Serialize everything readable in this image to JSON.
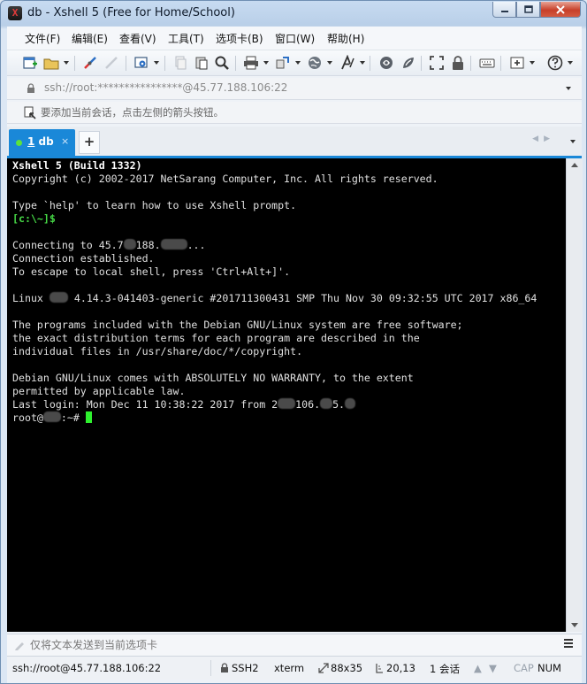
{
  "window": {
    "title": "db - Xshell 5 (Free for Home/School)",
    "icon_glyph": "X"
  },
  "menu": [
    {
      "label": "文件(F)"
    },
    {
      "label": "编辑(E)"
    },
    {
      "label": "查看(V)"
    },
    {
      "label": "工具(T)"
    },
    {
      "label": "选项卡(B)"
    },
    {
      "label": "窗口(W)"
    },
    {
      "label": "帮助(H)"
    }
  ],
  "address": {
    "value": "ssh://root:****************@45.77.188.106:22"
  },
  "session_hint": {
    "text": "要添加当前会话，点击左侧的箭头按钮。"
  },
  "tabs": [
    {
      "number": "1",
      "label": "db",
      "close": "×",
      "status_color": "#5be33d"
    }
  ],
  "tab_add": "+",
  "terminal": {
    "lines": [
      {
        "text": "Xshell 5 (Build 1332)",
        "style": "bold"
      },
      {
        "text": "Copyright (c) 2002-2017 NetSarang Computer, Inc. All rights reserved."
      },
      {
        "text": ""
      },
      {
        "text": "Type `help' to learn how to use Xshell prompt."
      },
      {
        "text": "[c:\\~]$",
        "style": "green"
      },
      {
        "text": ""
      },
      {
        "text_a": "Connecting to 45.7",
        "text_b": "188.",
        "text_c": "...",
        "redact": [
          1,
          2
        ]
      },
      {
        "text": "Connection established."
      },
      {
        "text": "To escape to local shell, press 'Ctrl+Alt+]'."
      },
      {
        "text": ""
      },
      {
        "text_a": "Linux ",
        "text_b": " 4.14.3-041403-generic #201711300431 SMP Thu Nov 30 09:32:55 UTC 2017 x86_64"
      },
      {
        "text": ""
      },
      {
        "text": "The programs included with the Debian GNU/Linux system are free software;"
      },
      {
        "text": "the exact distribution terms for each program are described in the"
      },
      {
        "text": "individual files in /usr/share/doc/*/copyright."
      },
      {
        "text": ""
      },
      {
        "text": "Debian GNU/Linux comes with ABSOLUTELY NO WARRANTY, to the extent"
      },
      {
        "text": "permitted by applicable law."
      },
      {
        "text_a": "Last login: Mon Dec 11 10:38:22 2017 from 2",
        "text_b": "106.",
        "text_c": "5."
      },
      {
        "text_a": "root@",
        "text_b": ":~# "
      }
    ],
    "colors": {
      "background": "#000000",
      "foreground": "#e0e0e0",
      "prompt": "#46d846",
      "cursor": "#2ef02e"
    }
  },
  "compose": {
    "placeholder": "仅将文本发送到当前选项卡"
  },
  "status": {
    "connection": "ssh://root@45.77.188.106:22",
    "protocol": "SSH2",
    "terminal_type": "xterm",
    "size": "88x35",
    "cursor_pos": "20,13",
    "sessions": "1 会话",
    "caps": "CAP",
    "num": "NUM"
  }
}
